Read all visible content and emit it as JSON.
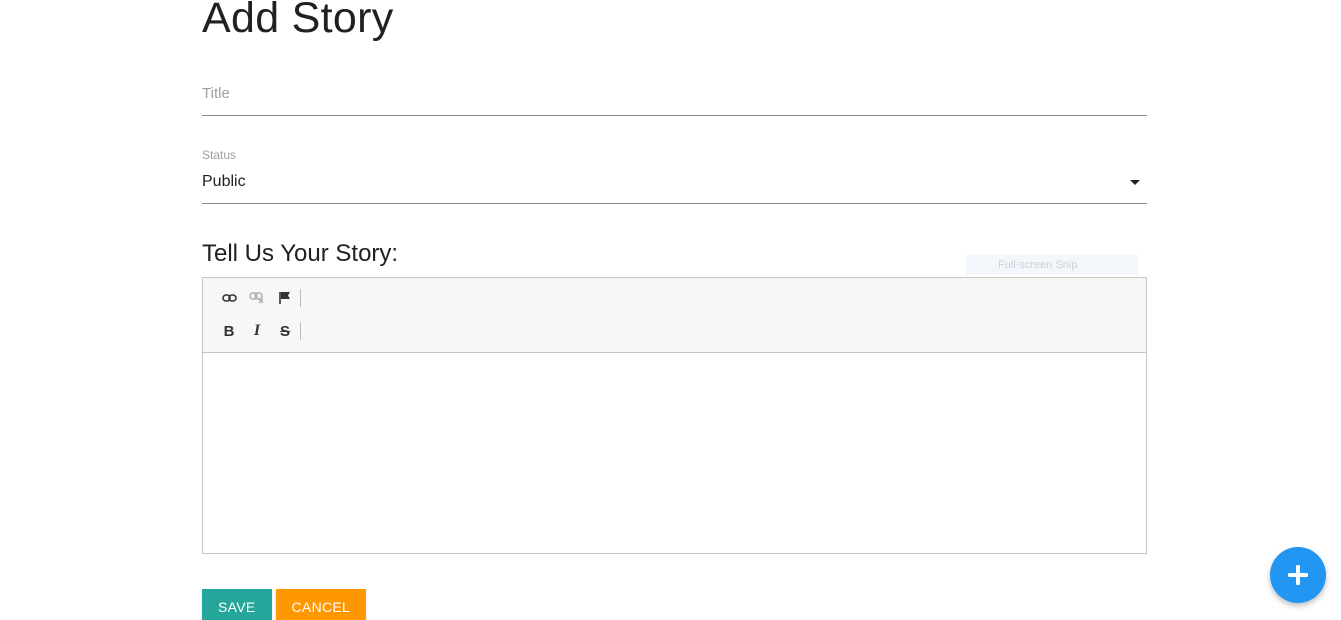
{
  "page": {
    "title": "Add Story"
  },
  "form": {
    "title_placeholder": "Title",
    "title_value": "",
    "status_label": "Status",
    "status_value": "Public",
    "story_heading": "Tell Us Your Story:",
    "editor_content": ""
  },
  "toolbar": {
    "row1": [
      {
        "name": "link-icon",
        "enabled": true
      },
      {
        "name": "unlink-icon",
        "enabled": false
      },
      {
        "name": "flag-icon",
        "enabled": true
      }
    ],
    "row2": [
      {
        "name": "bold-icon",
        "label": "B"
      },
      {
        "name": "italic-icon",
        "label": "I"
      },
      {
        "name": "strikethrough-icon",
        "label": "S"
      }
    ]
  },
  "overlay": {
    "snip_text": "Full-screen Snip"
  },
  "actions": {
    "save_label": "SAVE",
    "cancel_label": "CANCEL"
  },
  "fab": {
    "icon": "plus-icon"
  },
  "colors": {
    "save": "#26a69a",
    "cancel": "#ff9800",
    "fab": "#2196f3"
  }
}
